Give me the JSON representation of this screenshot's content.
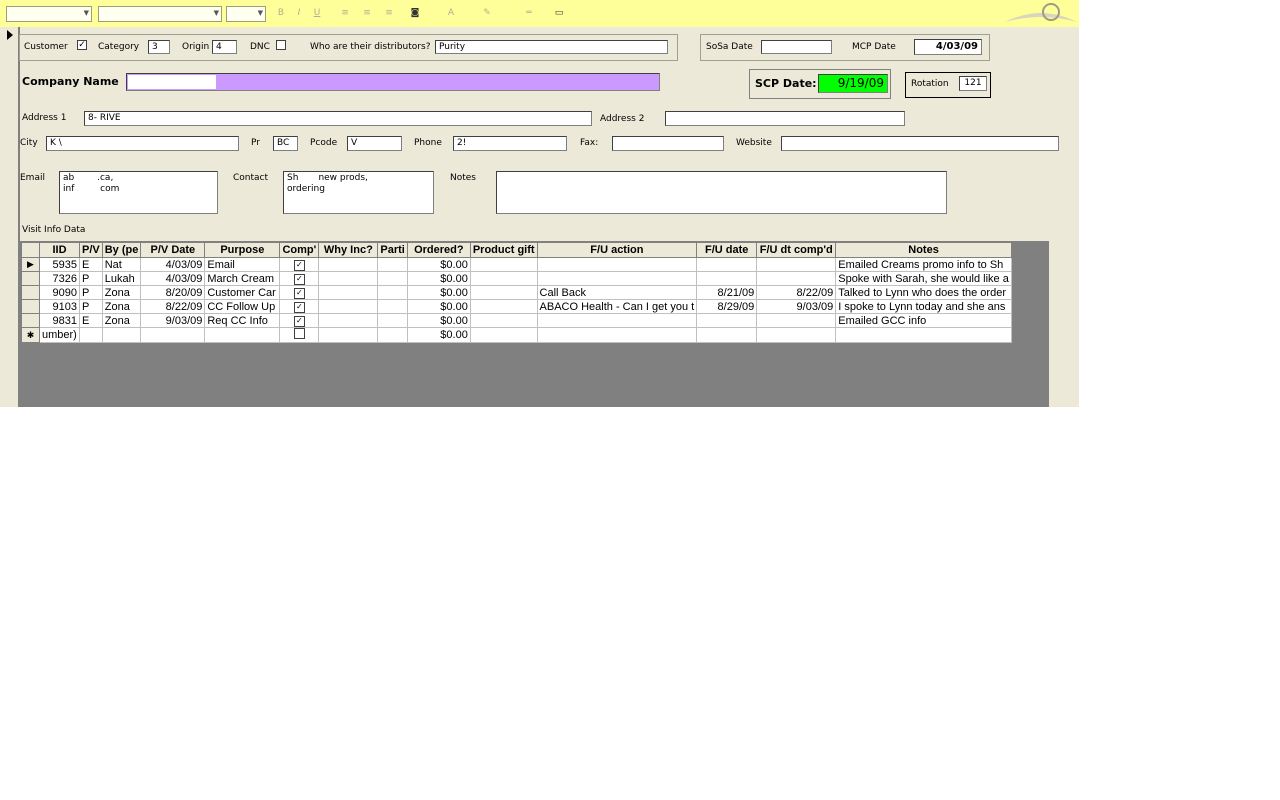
{
  "form": {
    "customer_label": "Customer",
    "customer_checked": true,
    "category_label": "Category",
    "category_value": "3",
    "origin_label": "Origin",
    "origin_value": "4",
    "dnc_label": "DNC",
    "dnc_checked": false,
    "distributors_label": "Who are their distributors?",
    "distributors_value": "Purity",
    "sosa_date_label": "SoSa Date",
    "sosa_date_value": "",
    "mcp_date_label": "MCP Date",
    "mcp_date_value": "4/03/09",
    "company_name_label": "Company Name",
    "company_name_value": "",
    "scp_date_label": "SCP Date:",
    "scp_date_value": "9/19/09",
    "rotation_label": "Rotation",
    "rotation_value": "121",
    "address1_label": "Address 1",
    "address1_value": "8-            RIVE",
    "address2_label": "Address 2",
    "address2_value": "",
    "city_label": "City",
    "city_value": "K       \\",
    "pr_label": "Pr",
    "pr_value": "BC",
    "pcode_label": "Pcode",
    "pcode_value": "V",
    "phone_label": "Phone",
    "phone_value": "2!",
    "fax_label": "Fax:",
    "fax_value": "",
    "website_label": "Website",
    "website_value": "",
    "email_label": "Email",
    "email_value": "ab        .ca,\ninf         com",
    "contact_label": "Contact",
    "contact_value": "Sh       new prods,\nordering",
    "notes_label": "Notes",
    "notes_value": "",
    "visit_info_label": "Visit Info Data"
  },
  "grid": {
    "columns": [
      "IID",
      "P/V",
      "By (pe",
      "P/V Date",
      "Purpose",
      "Comp'",
      "Why Inc?",
      "Parti",
      "Ordered?",
      "Product gift",
      "F/U action",
      "F/U date",
      "F/U dt comp'd",
      "Notes"
    ],
    "rows": [
      {
        "iid": "5935",
        "pv": "E",
        "by": "Nat",
        "date": "4/03/09",
        "purpose": "Email",
        "comp": true,
        "why": "",
        "parti": "",
        "ordered": "$0.00",
        "gift": "",
        "fu_action": "",
        "fu_date": "",
        "fu_comp": "",
        "notes": "Emailed Creams promo info to Sh"
      },
      {
        "iid": "7326",
        "pv": "P",
        "by": "Lukah",
        "date": "4/03/09",
        "purpose": "March Cream",
        "comp": true,
        "why": "",
        "parti": "",
        "ordered": "$0.00",
        "gift": "",
        "fu_action": "",
        "fu_date": "",
        "fu_comp": "",
        "notes": "Spoke with Sarah, she would like a"
      },
      {
        "iid": "9090",
        "pv": "P",
        "by": "Zona",
        "date": "8/20/09",
        "purpose": "Customer Car",
        "comp": true,
        "why": "",
        "parti": "",
        "ordered": "$0.00",
        "gift": "",
        "fu_action": "Call Back",
        "fu_date": "8/21/09",
        "fu_comp": "8/22/09",
        "notes": "Talked to Lynn who does the order"
      },
      {
        "iid": "9103",
        "pv": "P",
        "by": "Zona",
        "date": "8/22/09",
        "purpose": "CC Follow Up",
        "comp": true,
        "why": "",
        "parti": "",
        "ordered": "$0.00",
        "gift": "",
        "fu_action": "ABACO Health - Can I get you t",
        "fu_date": "8/29/09",
        "fu_comp": "9/03/09",
        "notes": "I spoke to Lynn today and she ans"
      },
      {
        "iid": "9831",
        "pv": "E",
        "by": "Zona",
        "date": "9/03/09",
        "purpose": "Req CC Info",
        "comp": true,
        "why": "",
        "parti": "",
        "ordered": "$0.00",
        "gift": "",
        "fu_action": "",
        "fu_date": "",
        "fu_comp": "",
        "notes": "Emailed GCC info"
      }
    ],
    "new_row": {
      "iid": "umber)",
      "ordered": "$0.00",
      "comp": false
    }
  },
  "colors": {
    "toolbar": "#ffff99",
    "form_bg": "#ece9d8",
    "company_field": "#cc99ff",
    "scp_field": "#00ff00",
    "grid_bg": "#808080"
  }
}
